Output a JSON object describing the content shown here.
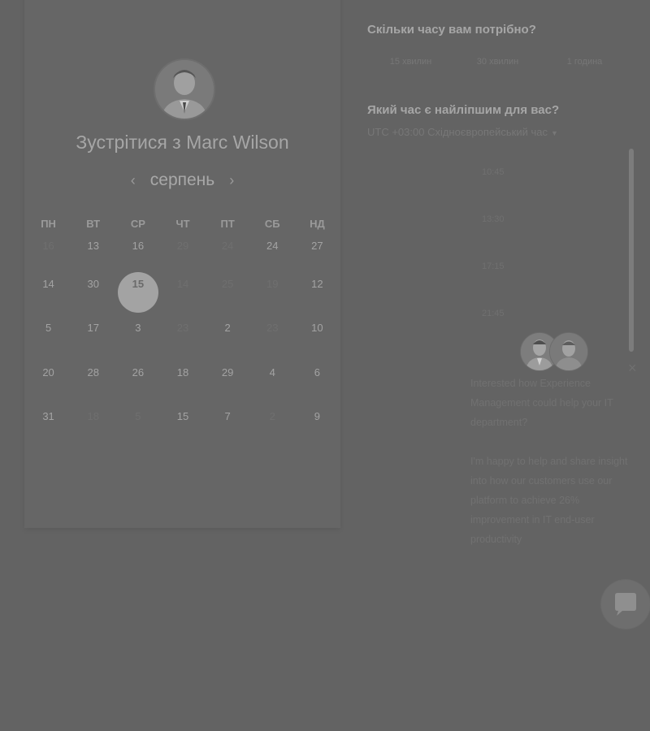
{
  "left": {
    "title": "Зустрітися з Marc Wilson",
    "month": "серпень",
    "prev_arrow": "‹",
    "next_arrow": "›",
    "weekdays": [
      "ПН",
      "ВТ",
      "СР",
      "ЧТ",
      "ПТ",
      "СБ",
      "НД"
    ],
    "weeks": [
      [
        {
          "d": "16",
          "dim": true
        },
        {
          "d": "13"
        },
        {
          "d": "16"
        },
        {
          "d": "29",
          "dim": true
        },
        {
          "d": "24",
          "dim": true
        },
        {
          "d": "24"
        },
        {
          "d": "27"
        }
      ],
      [
        {
          "d": "14"
        },
        {
          "d": "30"
        },
        {
          "d": "15",
          "selected": true
        },
        {
          "d": "14",
          "dim": true
        },
        {
          "d": "25",
          "dim": true
        },
        {
          "d": "19",
          "dim": true
        },
        {
          "d": "12"
        }
      ],
      [
        {
          "d": "5"
        },
        {
          "d": "17"
        },
        {
          "d": "3"
        },
        {
          "d": "23",
          "dim": true
        },
        {
          "d": "2"
        },
        {
          "d": "23",
          "dim": true
        },
        {
          "d": "10"
        }
      ],
      [
        {
          "d": "20"
        },
        {
          "d": "28"
        },
        {
          "d": "26"
        },
        {
          "d": "18"
        },
        {
          "d": "29"
        },
        {
          "d": "4"
        },
        {
          "d": "6"
        }
      ],
      [
        {
          "d": "31"
        },
        {
          "d": "18",
          "dim": true
        },
        {
          "d": "5",
          "dim": true
        },
        {
          "d": "15"
        },
        {
          "d": "7"
        },
        {
          "d": "2",
          "dim": true
        },
        {
          "d": "9"
        }
      ]
    ]
  },
  "right": {
    "q_duration": "Скільки часу вам потрібно?",
    "durations": [
      "15 хвилин",
      "30 хвилин",
      "1 година"
    ],
    "q_time": "Який час є найліпшим для вас?",
    "timezone": "UTC +03:00 Східноєвропейський час",
    "slots": [
      "10:45",
      "13:30",
      "17:15",
      "21:45"
    ]
  },
  "chat": {
    "message1": "Interested how Experience Management could help your IT department?",
    "message2": "I'm happy to help and share insight into how our customers use our platform to achieve 26% improvement in IT end-user productivity",
    "close": "×"
  }
}
